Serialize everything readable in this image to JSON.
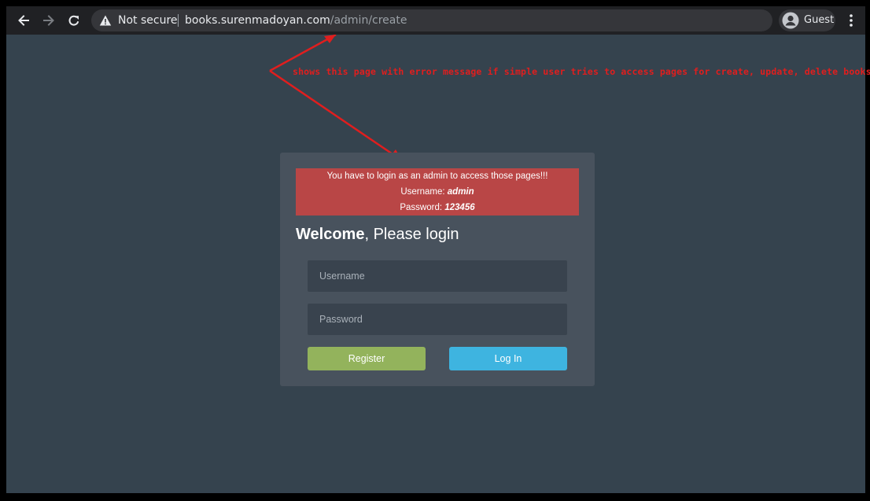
{
  "browser": {
    "security_label": "Not secure",
    "url_host": "books.surenmadoyan.com",
    "url_path": "/admin/create",
    "profile_label": "Guest",
    "icons": {
      "back": "arrow-left-icon",
      "forward": "arrow-right-icon",
      "reload": "reload-icon",
      "warning": "warning-triangle-icon",
      "profile": "account-circle-icon",
      "menu": "kebab-menu-icon"
    }
  },
  "annotation": {
    "text": "shows this page with error message if simple user tries to access pages for create, update, delete books",
    "color": "#e01e1e"
  },
  "login": {
    "alert": {
      "message": "You have to login as an admin to access those pages!!!",
      "username_label": "Username:",
      "username_value": "admin",
      "password_label": "Password:",
      "password_value": "123456",
      "color": "#b94646"
    },
    "welcome_strong": "Welcome",
    "welcome_rest": ", Please login",
    "username_placeholder": "Username",
    "password_placeholder": "Password",
    "register_label": "Register",
    "login_label": "Log In",
    "colors": {
      "register": "#93b35c",
      "login": "#3eb4e0",
      "page_background": "#35434e",
      "panel_background": "#48525d"
    }
  }
}
